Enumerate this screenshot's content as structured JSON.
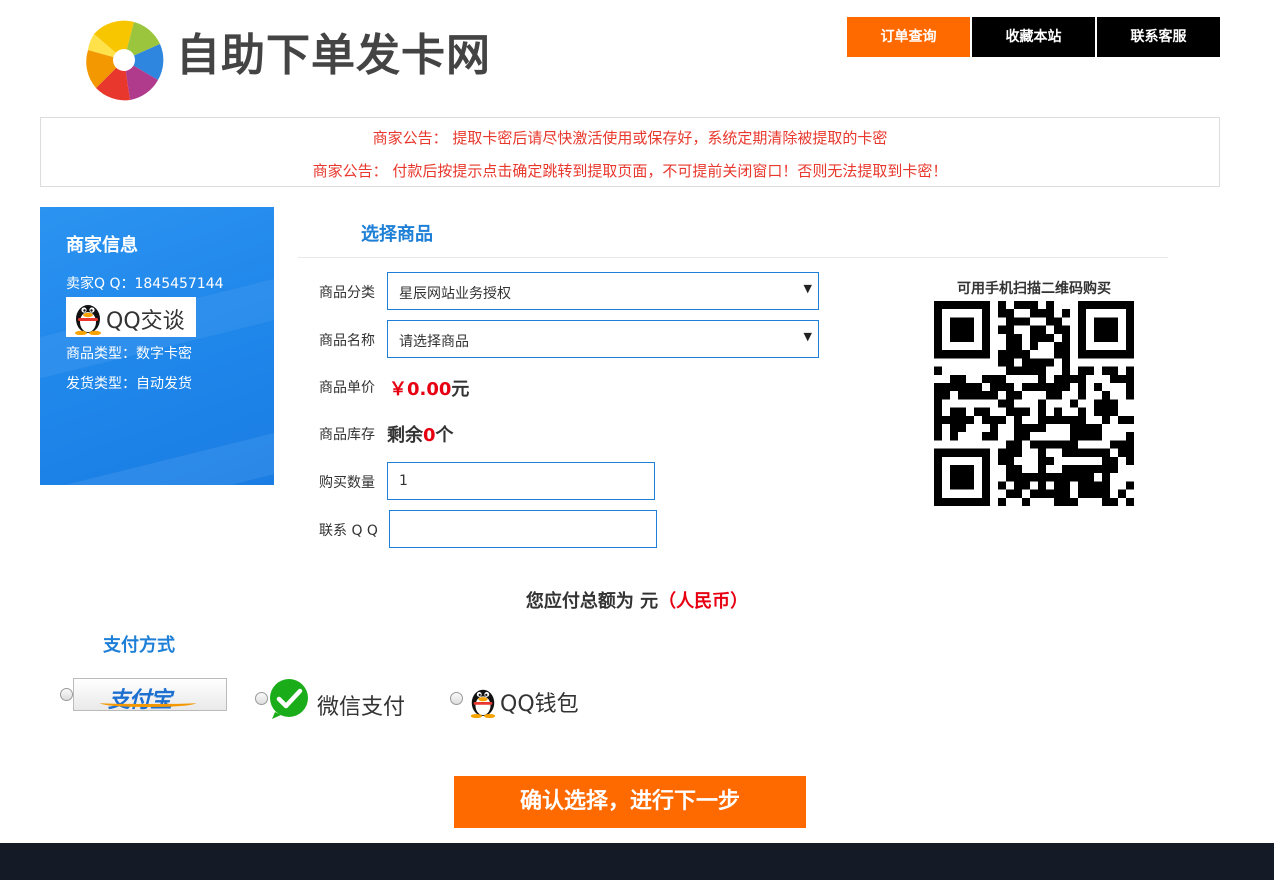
{
  "site": {
    "title": "自助下单发卡网"
  },
  "nav": {
    "items": [
      {
        "label": "订单查询",
        "active": true
      },
      {
        "label": "收藏本站",
        "active": false
      },
      {
        "label": "联系客服",
        "active": false
      }
    ]
  },
  "notices": [
    "商家公告： 提取卡密后请尽快激活使用或保存好，系统定期清除被提取的卡密",
    "商家公告： 付款后按提示点击确定跳转到提取页面，不可提前关闭窗口！否则无法提取到卡密！"
  ],
  "seller": {
    "title": "商家信息",
    "qq_line": "卖家Q Q：1845457144",
    "qq_chat_label": "QQ交谈",
    "product_type": "商品类型：数字卡密",
    "shipping_type": "发货类型：自动发货"
  },
  "form": {
    "section_title": "选择商品",
    "category_label": "商品分类",
    "category_value": "星辰网站业务授权",
    "product_label": "商品名称",
    "product_value": "请选择商品",
    "price_label": "商品单价",
    "price_value": "￥0.00",
    "price_unit": "元",
    "stock_label": "商品库存",
    "stock_prefix": "剩余",
    "stock_count": "0",
    "stock_suffix": "个",
    "quantity_label": "购买数量",
    "quantity_value": "1",
    "contact_label": "联系 Q Q",
    "contact_value": ""
  },
  "qr": {
    "caption": "可用手机扫描二维码购买"
  },
  "total": {
    "prefix": "您应付总额为",
    "unit": "元",
    "currency": "（人民币）"
  },
  "payment": {
    "title": "支付方式",
    "alipay_label": "支付宝",
    "wechat_label": "微信支付",
    "qqwallet_label": "QQ钱包"
  },
  "confirm_button": "确认选择，进行下一步",
  "colors": {
    "accent_orange": "#ff6a00",
    "nav_black": "#000000",
    "notice_red": "#e8382d",
    "price_red": "#e60012",
    "seller_blue": "#1f86ea",
    "heading_blue": "#1d7fd6",
    "footer": "#151b26"
  }
}
